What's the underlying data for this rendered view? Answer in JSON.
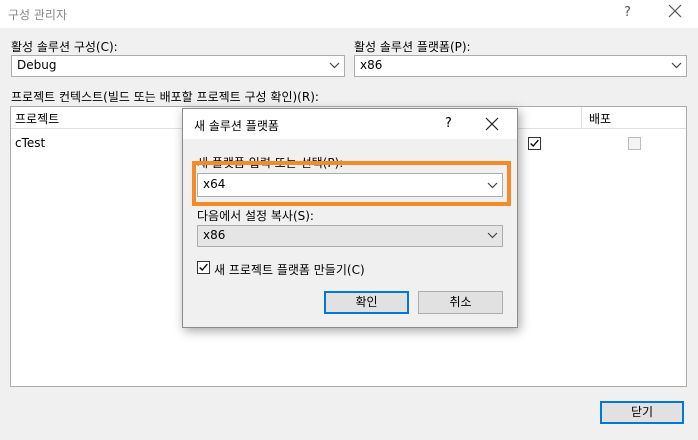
{
  "window": {
    "title": "구성 관리자",
    "help": "?",
    "close_icon": "close-icon"
  },
  "active_config": {
    "label": "활성 솔루션 구성(C):",
    "value": "Debug"
  },
  "active_platform": {
    "label": "활성 솔루션 플랫폼(P):",
    "value": "x86"
  },
  "project_context_label": "프로젝트 컨텍스트(빌드 또는 배포할 프로젝트 구성 확인)(R):",
  "grid": {
    "columns": [
      "프로젝트",
      "배포"
    ],
    "rows": [
      {
        "project": "cTest",
        "build_checked": true,
        "deploy_checked": false
      }
    ]
  },
  "close_button": "닫기",
  "dialog": {
    "title": "새 솔루션 플랫폼",
    "help": "?",
    "platform_label": "새 플랫폼 입력 또는 선택(P):",
    "platform_value": "x64",
    "copy_label": "다음에서 설정 복사(S):",
    "copy_value": "x86",
    "create_checkbox_label": "새 프로젝트 플랫폼 만들기(C)",
    "create_checked": true,
    "ok_button": "확인",
    "cancel_button": "취소"
  },
  "colors": {
    "highlight": "#f58a28",
    "default_button_border": "#0078d7"
  }
}
